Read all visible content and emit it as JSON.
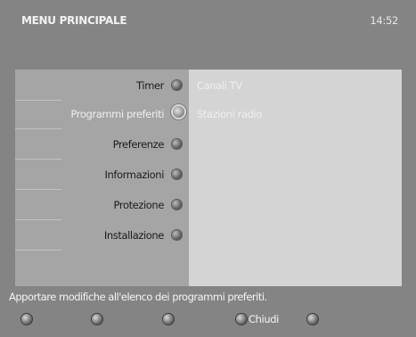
{
  "header": {
    "title": "MENU PRINCIPALE",
    "time": "14:52"
  },
  "menu": {
    "items": [
      {
        "label": "Timer",
        "icon": "knob-icon",
        "selected": false
      },
      {
        "label": "Programmi preferiti",
        "icon": "knob-ring-icon",
        "selected": true
      },
      {
        "label": "Preferenze",
        "icon": "knob-icon",
        "selected": false
      },
      {
        "label": "Informazioni",
        "icon": "knob-icon",
        "selected": false
      },
      {
        "label": "Protezione",
        "icon": "knob-icon",
        "selected": false
      },
      {
        "label": "Installazione",
        "icon": "knob-icon",
        "selected": false
      }
    ]
  },
  "submenu": {
    "items": [
      {
        "label": "Canali TV"
      },
      {
        "label": "Stazioni radio"
      }
    ]
  },
  "status": {
    "text": "Apportare modifiche all'elenco dei programmi preferiti."
  },
  "buttons": [
    {
      "label": "",
      "icon": "red-button-icon"
    },
    {
      "label": "",
      "icon": "green-button-icon"
    },
    {
      "label": "",
      "icon": "yellow-button-icon"
    },
    {
      "label": "Chiudi",
      "icon": "blue-button-icon"
    },
    {
      "label": "",
      "icon": "ok-button-icon"
    }
  ],
  "colors": {
    "background": "#848484",
    "menu_panel": "#a5a5a5",
    "submenu_panel": "#d4d4d4",
    "text_dark": "#1c1c1c",
    "text_light": "#f4f4f4"
  }
}
